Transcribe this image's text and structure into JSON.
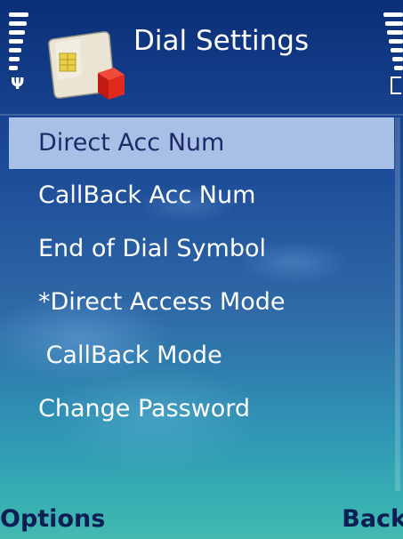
{
  "header": {
    "title": "Dial Settings",
    "icon": "sim-card-icon"
  },
  "status": {
    "signal_icon": "antenna-icon",
    "battery_icon": "battery-icon"
  },
  "menu": {
    "items": [
      {
        "label": "Direct Acc Num",
        "selected": true
      },
      {
        "label": "CallBack Acc Num",
        "selected": false
      },
      {
        "label": "End of Dial Symbol",
        "selected": false
      },
      {
        "label": "*Direct Access Mode",
        "selected": false
      },
      {
        "label": " CallBack Mode",
        "selected": false
      },
      {
        "label": "Change Password",
        "selected": false
      }
    ]
  },
  "softkeys": {
    "left": "Options",
    "right": "Back"
  },
  "colors": {
    "selection": "#a9c0e6",
    "softkey_text": "#0d1e55",
    "background_top": "#0b2f78",
    "background_bottom": "#43b9b0"
  }
}
